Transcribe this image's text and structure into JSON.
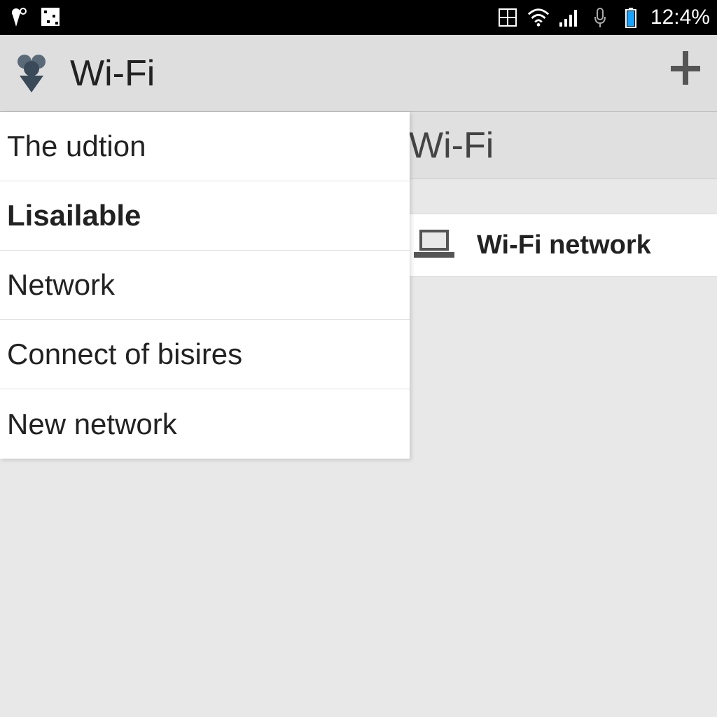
{
  "status_bar": {
    "battery_text": "12:4%"
  },
  "header": {
    "title": "Wi-Fi"
  },
  "right_panel": {
    "title": "Wi-Fi",
    "network_label": "Wi-Fi network"
  },
  "menu": {
    "items": [
      {
        "label": "The udtion",
        "bold": false
      },
      {
        "label": "Lisailable",
        "bold": true
      },
      {
        "label": "Network",
        "bold": false
      },
      {
        "label": "Connect  of bisires",
        "bold": false
      },
      {
        "label": "New network",
        "bold": false
      }
    ]
  }
}
